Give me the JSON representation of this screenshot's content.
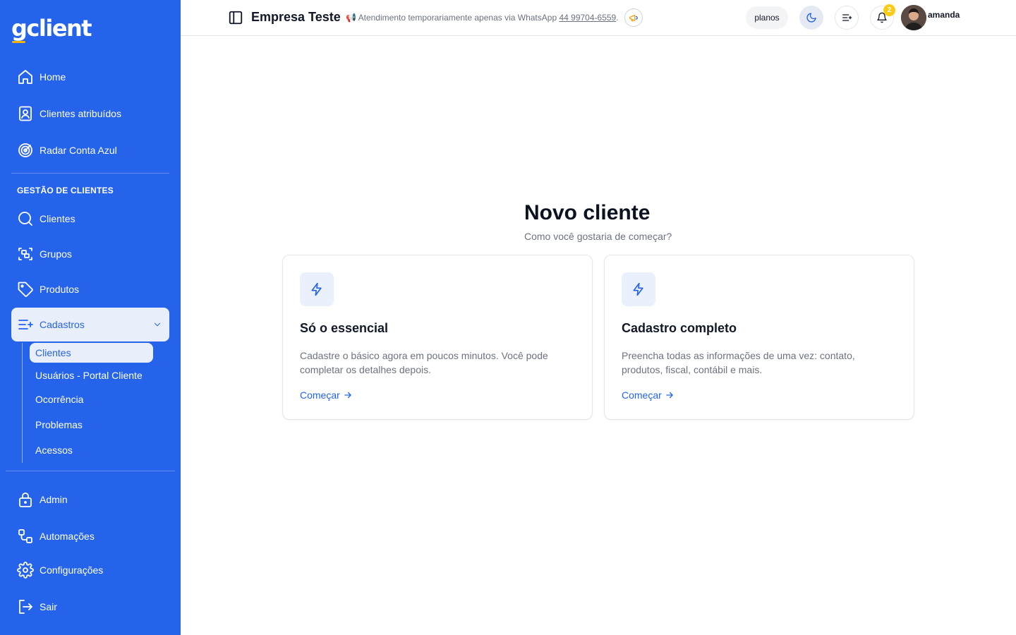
{
  "brand": {
    "logo_g": "g",
    "logo_rest": "client"
  },
  "sidebar": {
    "items": [
      {
        "label": "Home"
      },
      {
        "label": "Clientes atribuídos"
      },
      {
        "label": "Radar Conta Azul"
      }
    ],
    "section_title": "GESTÃO DE CLIENTES",
    "gestao_items": [
      {
        "label": "Clientes"
      },
      {
        "label": "Grupos"
      },
      {
        "label": "Produtos"
      },
      {
        "label": "Cadastros"
      }
    ],
    "cadastros_sub": [
      {
        "label": "Clientes"
      },
      {
        "label": "Usuários - Portal Cliente"
      },
      {
        "label": "Ocorrência"
      },
      {
        "label": "Problemas"
      },
      {
        "label": "Acessos"
      }
    ],
    "bottom_items": [
      {
        "label": "Admin"
      },
      {
        "label": "Automações"
      },
      {
        "label": "Configurações"
      },
      {
        "label": "Sair"
      }
    ]
  },
  "header": {
    "company": "Empresa Teste",
    "notice_emoji": "📢",
    "notice_text": "Atendimento temporariamente apenas via WhatsApp",
    "notice_phone": "44 99704-6559",
    "notice_end": ".",
    "plans_label": "planos",
    "notification_count": "2",
    "username": "amanda"
  },
  "main": {
    "title": "Novo cliente",
    "subtitle": "Como você gostaria de começar?",
    "cards": [
      {
        "title": "Só o essencial",
        "description": "Cadastre o básico agora em poucos minutos. Você pode completar os detalhes depois.",
        "link": "Começar"
      },
      {
        "title": "Cadastro completo",
        "description": "Preencha todas as informações de uma vez: contato, produtos, fiscal, contábil e mais.",
        "link": "Começar"
      }
    ]
  },
  "colors": {
    "sidebar_bg": "#2563eb",
    "accent": "#2563eb",
    "badge": "#facc15",
    "logo_underline": "#f5b301"
  }
}
